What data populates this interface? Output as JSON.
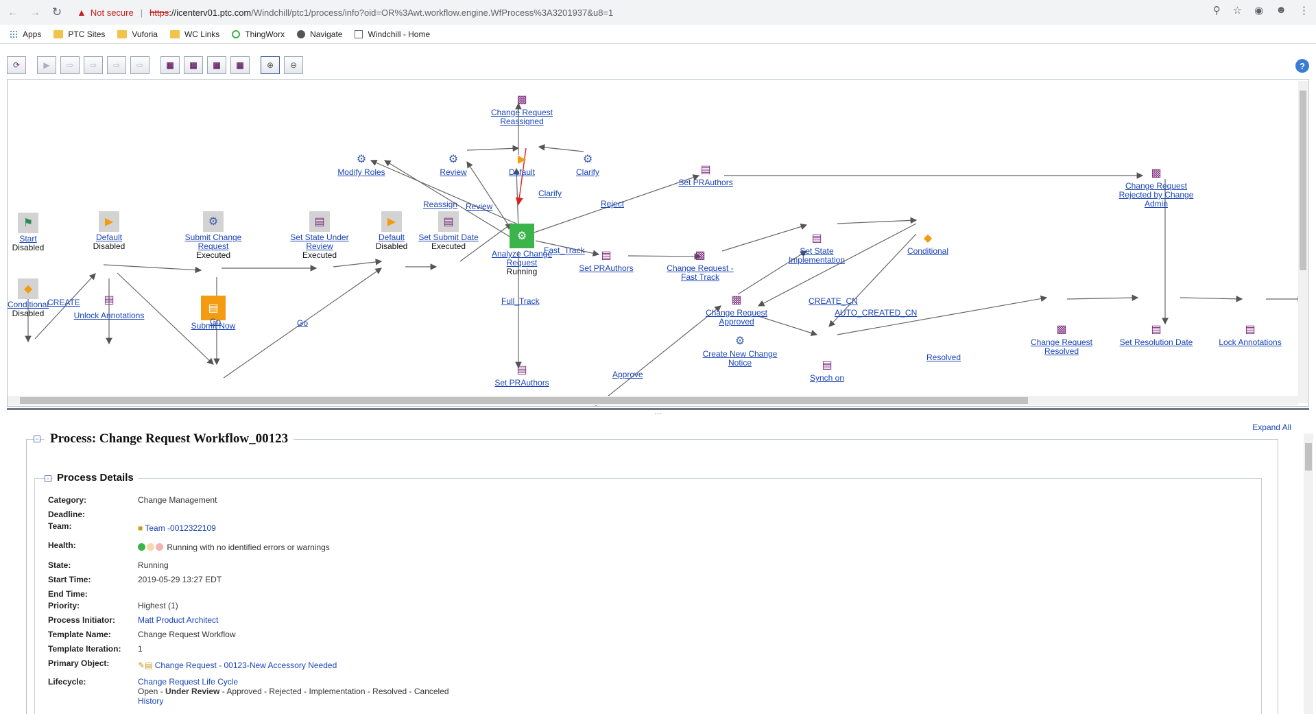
{
  "browser": {
    "security_text": "Not secure",
    "url_scheme": "https",
    "url_host": "://icenterv01.ptc.com",
    "url_path": "/Windchill/ptc1/process/info?oid=OR%3Awt.workflow.engine.WfProcess%3A3201937&u8=1",
    "bookmarks": [
      "Apps",
      "PTC Sites",
      "Vuforia",
      "WC Links",
      "ThingWorx",
      "Navigate",
      "Windchill - Home"
    ]
  },
  "graph": {
    "nodes": {
      "start": {
        "label": "Start",
        "state": "Disabled"
      },
      "conditional_left": {
        "label": "Conditional",
        "state": "Disabled"
      },
      "default1": {
        "label": "Default",
        "state": "Disabled"
      },
      "unlock": {
        "label": "Unlock Annotations",
        "state": ""
      },
      "submit_change": {
        "label": "Submit Change Request",
        "state": "Executed"
      },
      "submit_now": {
        "label": "Submit Now",
        "state": ""
      },
      "set_state_review": {
        "label": "Set State Under Review",
        "state": "Executed"
      },
      "default2": {
        "label": "Default",
        "state": "Disabled"
      },
      "set_submit_date": {
        "label": "Set Submit Date",
        "state": "Executed"
      },
      "analyze": {
        "label": "Analyze Change Request",
        "state": "Running"
      },
      "reassigned": {
        "label": "Change Request Reassigned",
        "state": ""
      },
      "modify_roles": {
        "label": "Modify Roles",
        "state": ""
      },
      "review": {
        "label": "Review",
        "state": ""
      },
      "default_top": {
        "label": "Default",
        "state": ""
      },
      "clarify": {
        "label": "Clarify",
        "state": ""
      },
      "set_prauthors_top": {
        "label": "Set PRAuthors",
        "state": ""
      },
      "set_prauthors_mid": {
        "label": "Set PRAuthors",
        "state": ""
      },
      "set_prauthors_bot": {
        "label": "Set PRAuthors",
        "state": ""
      },
      "cr_fast_track": {
        "label": "Change Request - Fast Track",
        "state": ""
      },
      "cr_approved": {
        "label": "Change Request Approved",
        "state": ""
      },
      "set_state_impl": {
        "label": "Set State Implementation",
        "state": ""
      },
      "conditional_right": {
        "label": "Conditional",
        "state": ""
      },
      "create_cn": {
        "label": "Create New Change Notice",
        "state": ""
      },
      "synch_on": {
        "label": "Synch on",
        "state": ""
      },
      "cr_rejected": {
        "label": "Change Request Rejected by Change Admin",
        "state": ""
      },
      "cr_resolved": {
        "label": "Change Request Resolved",
        "state": ""
      },
      "set_resolution": {
        "label": "Set Resolution Date",
        "state": ""
      },
      "lock": {
        "label": "Lock Annotations",
        "state": ""
      }
    },
    "edges": {
      "create": "CREATE",
      "go1": "Go",
      "go2": "Go",
      "reassign": "Reassign",
      "review": "Review",
      "clarify": "Clarify",
      "reject": "Reject",
      "fast_track": "Fast_Track",
      "full_track": "Full_Track",
      "approve": "Approve",
      "create_cn": "CREATE_CN",
      "auto_created_cn": "AUTO_CREATED_CN",
      "resolved": "Resolved"
    }
  },
  "expand_all": "Expand All",
  "process": {
    "title": "Process: Change Request Workflow_00123",
    "section_title": "Process Details",
    "fields": {
      "category": {
        "k": "Category:",
        "v": "Change Management"
      },
      "deadline": {
        "k": "Deadline:",
        "v": ""
      },
      "team": {
        "k": "Team:",
        "v": "Team -0012322109"
      },
      "health": {
        "k": "Health:",
        "v": "Running with no identified errors or warnings"
      },
      "state": {
        "k": "State:",
        "v": "Running"
      },
      "start_time": {
        "k": "Start Time:",
        "v": "2019-05-29 13:27 EDT"
      },
      "end_time": {
        "k": "End Time:",
        "v": ""
      },
      "priority": {
        "k": "Priority:",
        "v": "Highest (1)"
      },
      "initiator": {
        "k": "Process Initiator:",
        "v": "Matt Product Architect"
      },
      "template_name": {
        "k": "Template Name:",
        "v": "Change Request Workflow"
      },
      "template_iteration": {
        "k": "Template Iteration:",
        "v": "1"
      },
      "primary_object": {
        "k": "Primary Object:",
        "v": "Change Request - 00123-New Accessory Needed"
      },
      "lifecycle": {
        "k": "Lifecycle:",
        "v": "Change Request Life Cycle"
      }
    },
    "lifecycle_states": {
      "open": "Open -",
      "current": "Under Review",
      "rest": "- Approved - Rejected - Implementation - Resolved - Canceled"
    },
    "history": "History"
  },
  "colors": {
    "link": "#1a44b8",
    "running_green": "#3cb44b",
    "orange": "#f39c12",
    "task_purple": "#7b2d7b"
  }
}
